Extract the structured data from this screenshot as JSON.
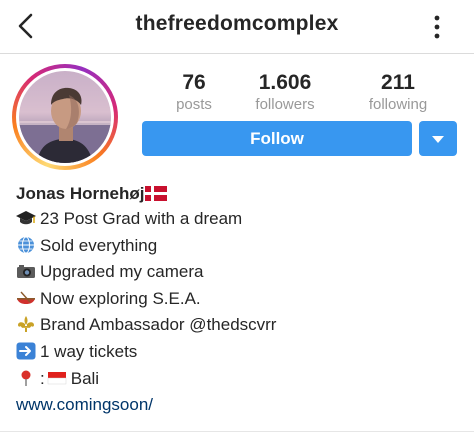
{
  "header": {
    "username": "thefreedomcomplex",
    "back_icon": "chevron-left-icon",
    "more_icon": "vertical-ellipsis-icon"
  },
  "stats": {
    "posts_count": "76",
    "posts_label": "posts",
    "followers_count": "1.606",
    "followers_label": "followers",
    "following_count": "211",
    "following_label": "following"
  },
  "actions": {
    "follow_label": "Follow",
    "dropdown_icon": "caret-down-icon"
  },
  "profile": {
    "name": "Jonas Hornehøj",
    "bio_lines": [
      {
        "icon": "graduation-cap-icon",
        "text": "23 Post Grad with a dream"
      },
      {
        "icon": "globe-icon",
        "text": "Sold everything"
      },
      {
        "icon": "camera-icon",
        "text": "Upgraded my camera"
      },
      {
        "icon": "canoe-icon",
        "text": "Now exploring S.E.A."
      },
      {
        "icon": "fleur-de-lis-icon",
        "text": "Brand Ambassador @thedscvrr"
      },
      {
        "icon": "right-arrow-icon",
        "text": "1 way tickets"
      },
      {
        "icon": "pin-icon",
        "text": ":"
      },
      {
        "icon": "indonesia-flag-icon",
        "text": "Bali"
      }
    ],
    "website": "www.comingsoon/"
  },
  "colors": {
    "follow_blue": "#3897f0",
    "link_color": "#003569",
    "secondary_text": "#999999"
  }
}
